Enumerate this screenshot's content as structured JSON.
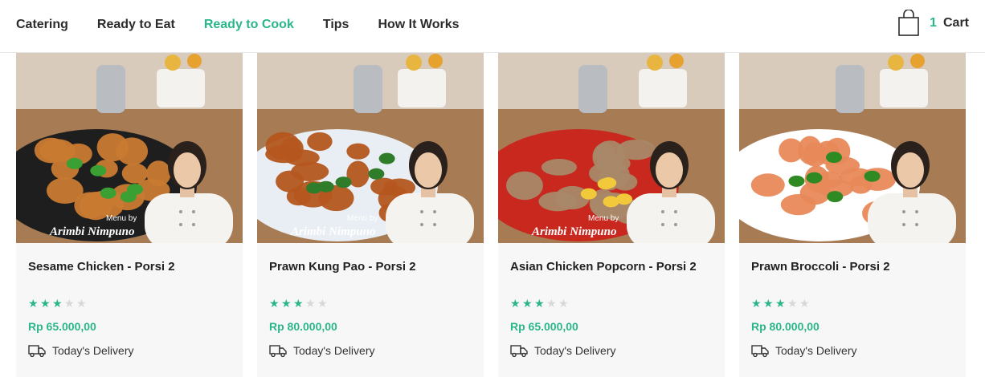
{
  "nav": {
    "items": [
      {
        "label": "Catering",
        "active": false
      },
      {
        "label": "Ready to Eat",
        "active": false
      },
      {
        "label": "Ready to Cook",
        "active": true
      },
      {
        "label": "Tips",
        "active": false
      },
      {
        "label": "How It Works",
        "active": false
      }
    ]
  },
  "cart": {
    "count": "1",
    "label": "Cart",
    "icon": "shopping-bag-icon"
  },
  "colors": {
    "accent": "#2bb58a",
    "card_bg": "#f7f7f7",
    "star_off": "#d8d8d8"
  },
  "watermark": {
    "line1": "Menu by",
    "line2": "Arimbi Nimpuno"
  },
  "products": [
    {
      "title": "Sesame Chicken - Porsi 2",
      "rating": 3,
      "max_rating": 5,
      "price": "Rp 65.000,00",
      "delivery": "Today's Delivery",
      "plate": "#1e1e1e",
      "food": "#c97a32",
      "accent": "#3aa033"
    },
    {
      "title": "Prawn Kung Pao - Porsi 2",
      "rating": 3,
      "max_rating": 5,
      "price": "Rp 80.000,00",
      "delivery": "Today's Delivery",
      "plate": "#e8eef4",
      "food": "#b4561e",
      "accent": "#2f7d2a"
    },
    {
      "title": "Asian Chicken Popcorn - Porsi 2",
      "rating": 3,
      "max_rating": 5,
      "price": "Rp 65.000,00",
      "delivery": "Today's Delivery",
      "plate": "#c8281e",
      "food": "#a88868",
      "accent": "#f2c93a"
    },
    {
      "title": "Prawn Broccoli - Porsi 2",
      "rating": 3,
      "max_rating": 5,
      "price": "Rp 80.000,00",
      "delivery": "Today's Delivery",
      "plate": "#ffffff",
      "food": "#e8895a",
      "accent": "#2f8a23"
    }
  ]
}
